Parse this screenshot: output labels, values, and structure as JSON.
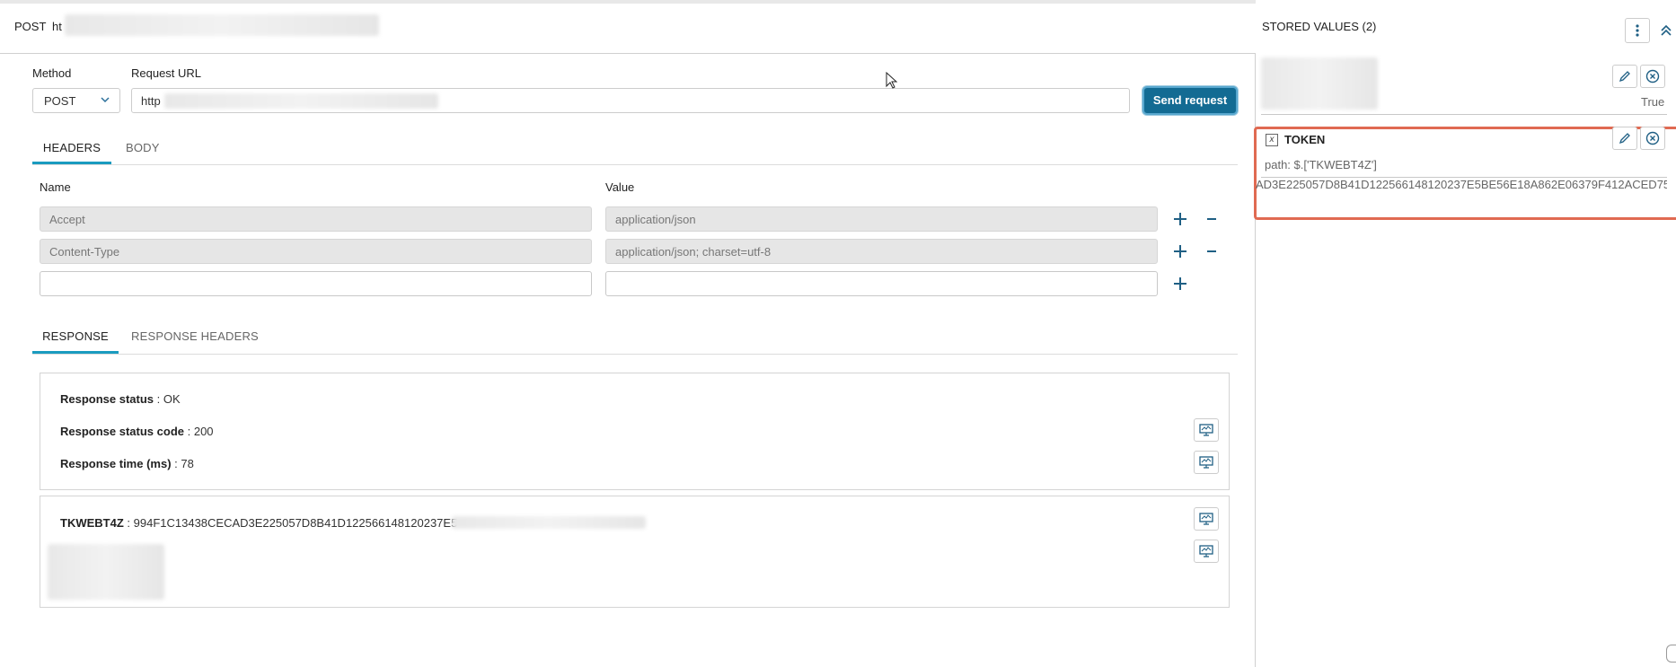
{
  "top": {
    "method": "POST",
    "url": "ht"
  },
  "request": {
    "method_label": "Method",
    "url_label": "Request URL",
    "method_value": "POST",
    "url_value": "http",
    "send_label": "Send request"
  },
  "tabs1": {
    "headers": "HEADERS",
    "body": "BODY"
  },
  "headers_table": {
    "name_col": "Name",
    "value_col": "Value",
    "rows": [
      {
        "name": "Accept",
        "value": "application/json"
      },
      {
        "name": "Content-Type",
        "value": "application/json; charset=utf-8"
      },
      {
        "name": "",
        "value": ""
      }
    ]
  },
  "tabs2": {
    "response": "RESPONSE",
    "response_headers": "RESPONSE HEADERS"
  },
  "response": {
    "status_label": "Response status",
    "status_value": "OK",
    "code_label": "Response status code",
    "code_value": "200",
    "time_label": "Response time (ms)",
    "time_value": "78",
    "token_key": "TKWEBT4Z",
    "token_value": "994F1C13438CECAD3E225057D8B41D122566148120237E5"
  },
  "stored": {
    "title": "STORED VALUES (2)",
    "item1_value": "True",
    "item2_icon": "x",
    "item2_name": "TOKEN",
    "item2_path": "path: $.['TKWEBT4Z']",
    "item2_value": "AD3E225057D8B41D122566148120237E5BE56E18A862E06379F412ACED75"
  },
  "icons": [
    "chevron-down-icon",
    "plus-icon",
    "minus-icon",
    "monitor-icon",
    "pencil-icon",
    "close-circle-icon",
    "kebab-icon",
    "collapse-up-icon",
    "variable-icon",
    "mouse-cursor-icon"
  ],
  "colors": {
    "primary": "#136b93",
    "tab_active": "#1a9bbf",
    "highlight": "#e06a52"
  }
}
